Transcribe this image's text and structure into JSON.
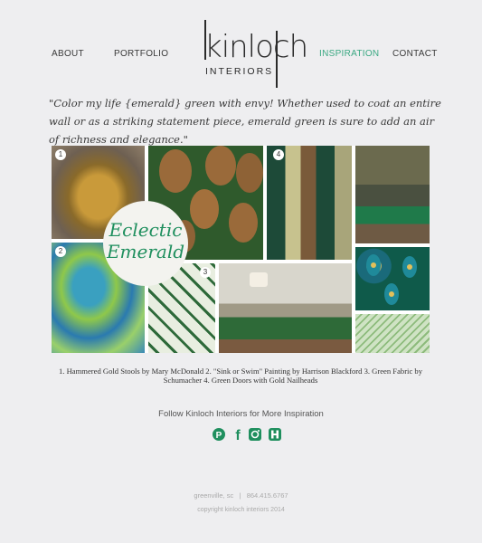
{
  "nav": {
    "about": "ABOUT",
    "portfolio": "PORTFOLIO",
    "inspiration": "INSPIRATION",
    "contact": "CONTACT"
  },
  "logo": {
    "word": "kinloch",
    "sub": "INTERIORS"
  },
  "quote": "\"Color my life {emerald} green with envy! Whether used to coat an entire wall or as a striking statement piece, emerald green is sure to add an air of richness and elegance.\"",
  "collage": {
    "badge_line1": "Eclectic",
    "badge_line2": "Emerald",
    "numbers": [
      "1",
      "2",
      "3",
      "4"
    ]
  },
  "caption": "1. Hammered Gold Stools by Mary McDonald   2. \"Sink or Swim\" Painting by Harrison Blackford   3. Green Fabric by Schumacher 4. Green Doors with Gold Nailheads",
  "follow": "Follow Kinloch Interiors for More Inspiration",
  "social_icons": [
    "pinterest-icon",
    "facebook-icon",
    "instagram-icon",
    "houzz-icon"
  ],
  "footer": {
    "location": "greenville, sc",
    "separator": "|",
    "phone": "864.415.6767",
    "copyright": "copyright kinloch interiors 2014"
  },
  "colors": {
    "accent": "#3aa882",
    "emerald": "#1f8f5e",
    "background": "#eeeef0"
  }
}
